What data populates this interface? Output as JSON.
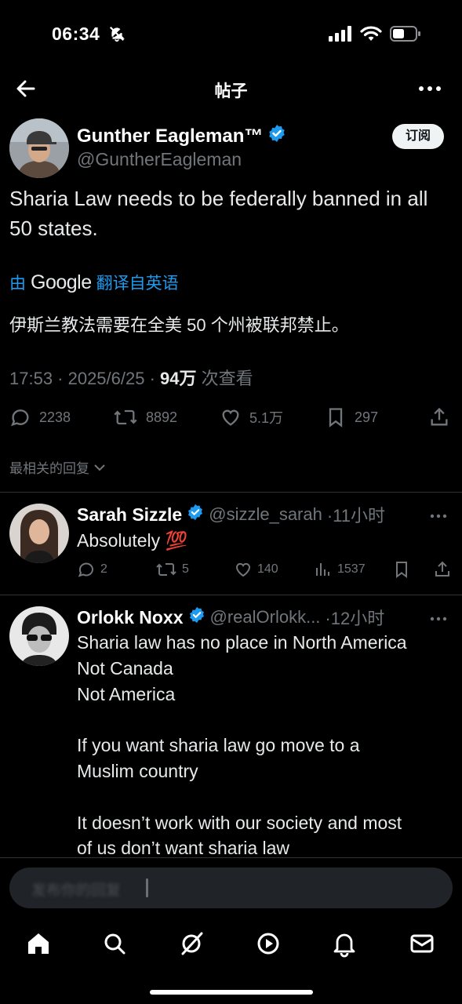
{
  "status_bar": {
    "time": "06:34"
  },
  "nav": {
    "title": "帖子"
  },
  "post": {
    "author_name": "Gunther Eagleman™",
    "author_handle": "@GuntherEagleman",
    "subscribe_label": "订阅",
    "text": "Sharia Law needs to be federally banned in all 50 states.",
    "translate_by": "由",
    "translate_google": "Google",
    "translate_suffix": "翻译自英语",
    "translated_text": "伊斯兰教法需要在全美 50 个州被联邦禁止。",
    "timestamp": "17:53 · 2025/6/25 · ",
    "views": "94万",
    "views_label": " 次查看",
    "replies": "2238",
    "reposts": "8892",
    "likes": "5.1万",
    "bookmarks": "297",
    "colors": {
      "verified": "#1d9bf0",
      "link": "#1d9bf0"
    }
  },
  "sort_label": "最相关的回复",
  "replies": [
    {
      "name": "Sarah Sizzle",
      "handle": "@sizzle_sarah",
      "age": "·11小时",
      "text": "Absolutely 💯",
      "reply_count": "2",
      "repost_count": "5",
      "like_count": "140",
      "view_count": "1537"
    },
    {
      "name": "Orlokk Noxx",
      "handle": "@realOrlokk...",
      "age": "·12小时",
      "lines": [
        "Sharia law has no place in North America",
        "Not Canada",
        "Not America",
        "",
        "If you want sharia law go move to a",
        "Muslim country",
        "",
        "It doesn’t work with our society and most",
        "of us don’t want sharia law"
      ]
    }
  ],
  "compose": {
    "placeholder": "发布你的回复"
  },
  "tabbar": {
    "tabs": [
      "home-icon",
      "search-icon",
      "grok-icon",
      "video-icon",
      "notifications-icon",
      "messages-icon"
    ]
  }
}
